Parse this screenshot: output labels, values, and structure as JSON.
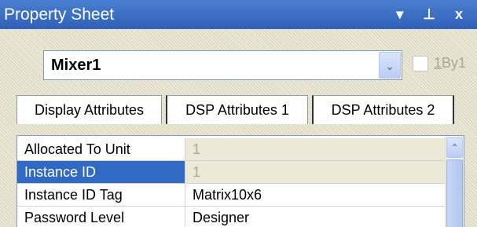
{
  "window": {
    "title": "Property Sheet",
    "controls": {
      "dropdown": "▾",
      "pin": "⊥",
      "close": "x"
    }
  },
  "object_selector": {
    "value": "Mixer1",
    "arrow": "⌄"
  },
  "checkbox": {
    "label_underlined": "1",
    "label_rest": "By1",
    "checked": false,
    "enabled": false
  },
  "tabs": [
    {
      "label": "Display Attributes"
    },
    {
      "label": "DSP Attributes 1",
      "active": true
    },
    {
      "label": "DSP Attributes 2"
    }
  ],
  "properties": [
    {
      "name": "Allocated To Unit",
      "value": "1",
      "readonly": true
    },
    {
      "name": "Instance ID",
      "value": "1",
      "readonly": true,
      "selected": true
    },
    {
      "name": "Instance ID Tag",
      "value": "Matrix10x6"
    },
    {
      "name": "Password Level",
      "value": "Designer"
    }
  ],
  "scrollbar": {
    "up_arrow": "⌃"
  },
  "colors": {
    "title_bar": "#3c6ec6",
    "selection": "#316ac5",
    "readonly_bg": "#ECE9D8",
    "disabled_text": "#aca899"
  }
}
